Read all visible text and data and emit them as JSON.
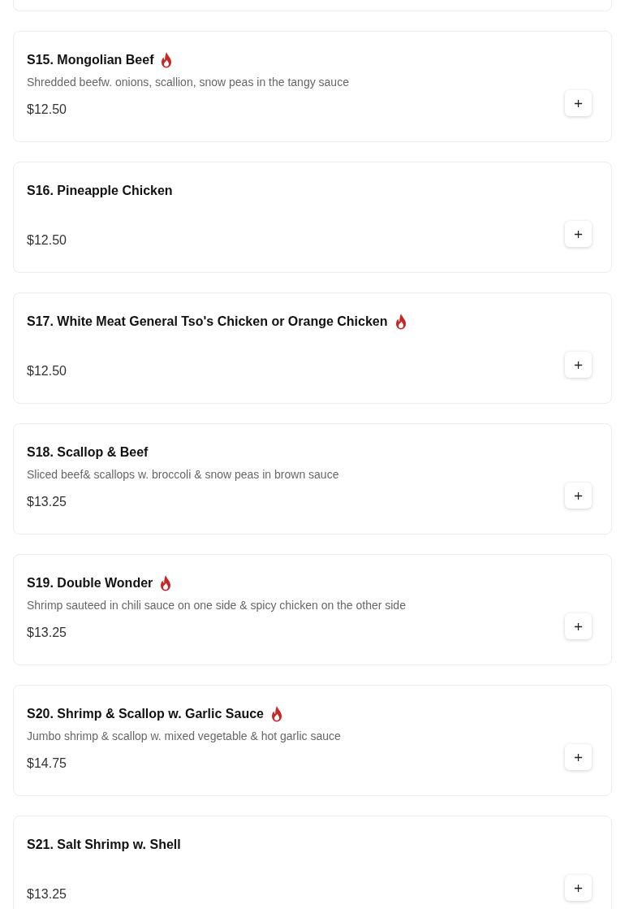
{
  "items": [
    {
      "name": "S15. Mongolian Beef",
      "spicy": true,
      "description": "Shredded beefw. onions, scallion, snow peas in the tangy sauce",
      "price": "$12.50"
    },
    {
      "name": "S16. Pineapple Chicken",
      "spicy": false,
      "price": "$12.50"
    },
    {
      "name": "S17. White Meat General Tso's Chicken or Orange Chicken",
      "spicy": true,
      "price": "$12.50"
    },
    {
      "name": "S18. Scallop & Beef",
      "spicy": false,
      "description": "Sliced beef& scallops w. broccoli & snow peas in brown sauce",
      "price": "$13.25"
    },
    {
      "name": "S19. Double Wonder",
      "spicy": true,
      "description": "Shrimp sauteed in chili sauce on one side & spicy chicken on the other side",
      "price": "$13.25"
    },
    {
      "name": "S20. Shrimp & Scallop w. Garlic Sauce",
      "spicy": true,
      "description": "Jumbo shrimp & scallop w. mixed vegetable & hot garlic sauce",
      "price": "$14.75"
    },
    {
      "name": "S21. Salt Shrimp w. Shell",
      "spicy": false,
      "price": "$13.25"
    }
  ]
}
